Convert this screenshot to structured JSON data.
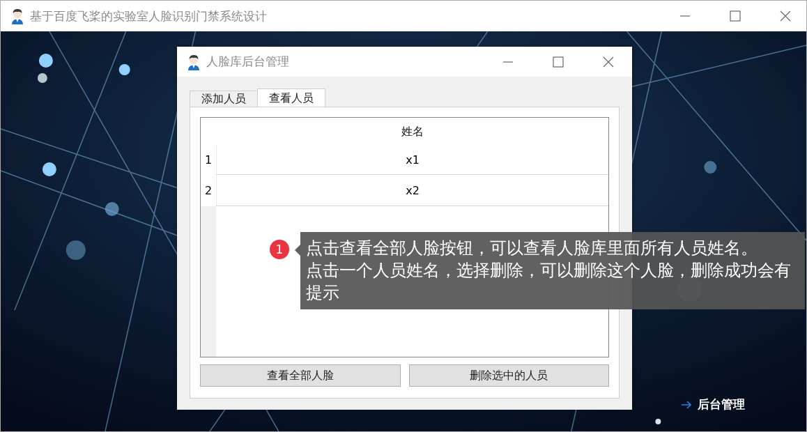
{
  "window": {
    "title": "基于百度飞桨的实验室人脸识别门禁系统设计"
  },
  "admin_link": {
    "label": "后台管理"
  },
  "dialog": {
    "title": "人脸库后台管理",
    "tabs": [
      {
        "label": "添加人员",
        "selected": false
      },
      {
        "label": "查看人员",
        "selected": true
      }
    ],
    "table": {
      "columns": [
        "姓名"
      ],
      "rows": [
        {
          "index": "1",
          "name": "x1"
        },
        {
          "index": "2",
          "name": "x2"
        }
      ]
    },
    "buttons": [
      "查看全部人脸",
      "删除选中的人员"
    ]
  },
  "callout": {
    "number": "1",
    "paragraphs": [
      "点击查看全部人脸按钮，可以查看人脸库里面所有人员姓名。",
      "点击一个人员姓名，选择删除，可以删除这个人脸，删除成功会有提示"
    ]
  }
}
